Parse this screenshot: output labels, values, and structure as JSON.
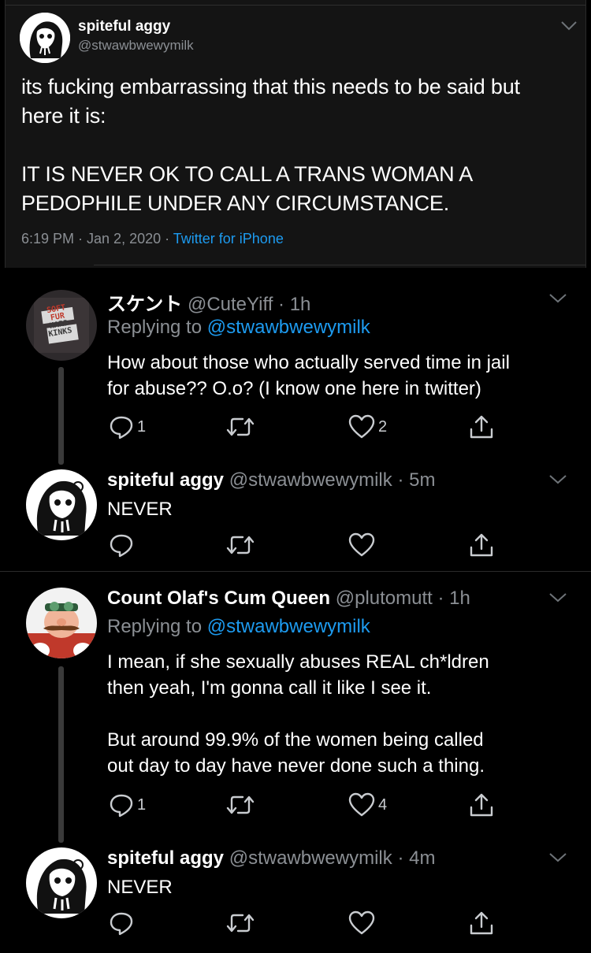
{
  "original_tweet": {
    "name": "spiteful aggy",
    "handle": "@stwawbwewymilk",
    "text_line1": "its fucking embarrassing that this needs to be said but",
    "text_line2": "here it is:",
    "text_line3": "IT IS NEVER OK TO CALL A TRANS WOMAN A",
    "text_line4": "PEDOPHILE UNDER ANY CIRCUMSTANCE.",
    "time": "6:19 PM · Jan 2, 2020 · ",
    "source": "Twitter for iPhone"
  },
  "replies": [
    {
      "name": "スケント",
      "handle": "@CuteYiff",
      "time": "· 1h",
      "replying_prefix": "Replying to ",
      "replying_to": "@stwawbwewymilk",
      "line1": "How about those who actually served time in jail",
      "line2": "for abuse?? O.o? (I know one here in twitter)",
      "reply_count": "1",
      "retweet_count": "",
      "like_count": "2",
      "avatar_text1": "SOFT",
      "avatar_text2": "FUR",
      "avatar_text3": "HARD",
      "avatar_text4": "KINKS"
    },
    {
      "name": "spiteful aggy",
      "handle": "@stwawbwewymilk",
      "time": "· 5m",
      "line1": "NEVER",
      "reply_count": "",
      "like_count": ""
    },
    {
      "name": "Count Olaf's Cum Queen",
      "handle": "@plutomutt",
      "time": "· 1h",
      "replying_prefix": "Replying to ",
      "replying_to": "@stwawbwewymilk",
      "line1": "I mean, if she sexually abuses REAL ch*ldren",
      "line2": "then yeah, I'm gonna call it like I see it.",
      "line3": "But around 99.9% of the women being called",
      "line4": "out day to day have never done such a thing.",
      "reply_count": "1",
      "like_count": "4"
    },
    {
      "name": "spiteful aggy",
      "handle": "@stwawbwewymilk",
      "time": "· 4m",
      "line1": "NEVER",
      "reply_count": "",
      "like_count": ""
    }
  ],
  "colors": {
    "background": "#000000",
    "link_blue": "#1d9bf0",
    "muted_gray": "#8b8f94",
    "thread_line": "#3a3a3a"
  },
  "icons": [
    "reply-icon",
    "retweet-icon",
    "like-icon",
    "share-icon",
    "chevron-down-icon"
  ]
}
